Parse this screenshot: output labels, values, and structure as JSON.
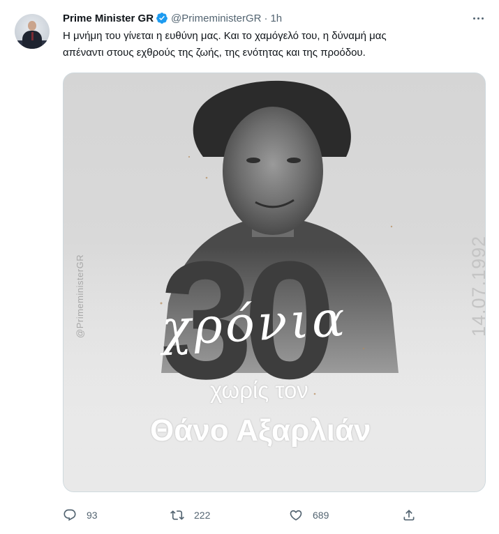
{
  "tweet": {
    "author_name": "Prime Minister GR",
    "handle": "@PrimeministerGR",
    "separator": "·",
    "time": "1h",
    "text_line1": "Η μνήμη του γίνεται η ευθύνη μας. Και το χαμόγελό του, η δύναμή μας",
    "text_line2": "απέναντι στους εχθρούς της ζωής, της ενότητας και της προόδου."
  },
  "media": {
    "watermark": "@PrimeministerGR",
    "date": "14.07.1992",
    "big_number": "30",
    "script_word": "χρόνια",
    "line_without": "χωρίς τον",
    "line_name": "Θάνο Αξαρλιάν"
  },
  "actions": {
    "reply_count": "93",
    "retweet_count": "222",
    "like_count": "689"
  },
  "icons": {
    "verified": "verified-badge-icon",
    "more": "more-options-icon",
    "reply": "reply-icon",
    "retweet": "retweet-icon",
    "like": "heart-icon",
    "share": "share-icon"
  },
  "colors": {
    "verified_blue": "#1d9bf0",
    "secondary_text": "#536471",
    "primary_text": "#0f1419"
  }
}
